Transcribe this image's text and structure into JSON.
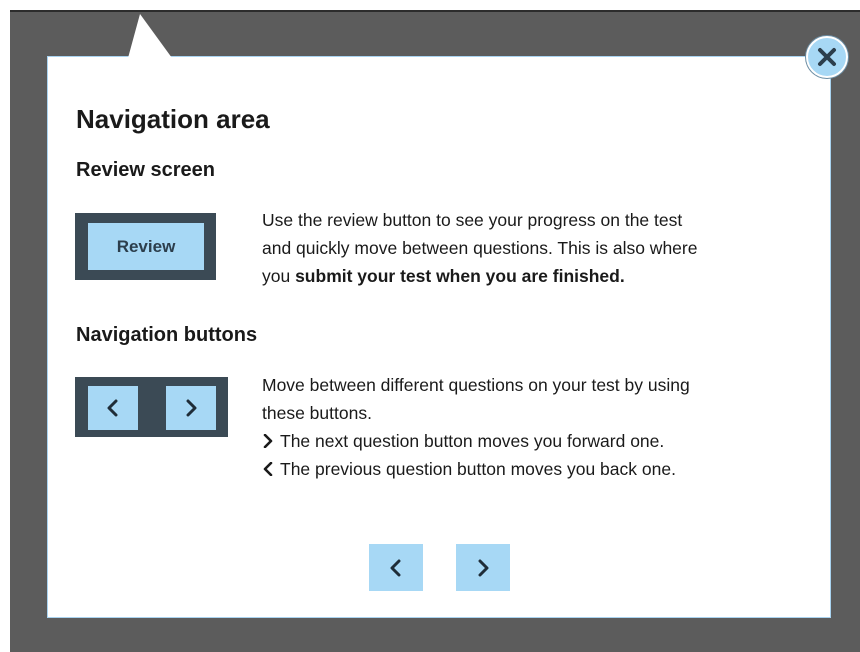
{
  "dialog": {
    "title": "Navigation area",
    "close_icon": "close-icon",
    "sections": {
      "review": {
        "heading": "Review screen",
        "button_label": "Review",
        "text_normal_1": "Use the review button to see your progress on the test",
        "text_normal_2": "and quickly move between questions. This is also where",
        "text_normal_3": "you ",
        "text_bold": "submit your test when you are finished."
      },
      "navigation": {
        "heading": "Navigation buttons",
        "line_1": "Move between different questions on your test by using",
        "line_2": "these buttons.",
        "next_desc": "The next question button moves you forward one.",
        "prev_desc": "The previous question button moves you back one."
      }
    },
    "footer": {
      "prev_icon": "chevron-left-icon",
      "next_icon": "chevron-right-icon"
    }
  },
  "colors": {
    "backdrop": "#5c5c5c",
    "panel": "#3b4a55",
    "accent": "#a7d8f5"
  }
}
